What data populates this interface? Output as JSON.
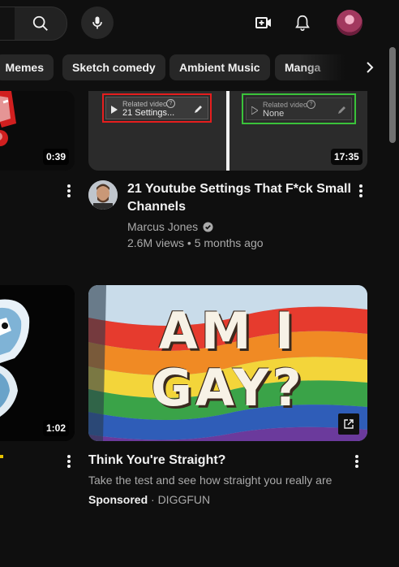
{
  "topbar": {
    "search_icon": "search-icon",
    "mic_icon": "mic-icon",
    "create_icon": "create-video-icon",
    "bell_icon": "bell-icon"
  },
  "chips": [
    "Memes",
    "Sketch comedy",
    "Ambient Music",
    "Manga"
  ],
  "video1": {
    "left_duration": "0:39",
    "duration": "17:35",
    "panel_left": {
      "label": "Related video",
      "value": "21 Settings..."
    },
    "panel_right": {
      "label": "Related video",
      "value": "None"
    },
    "title_line1": "21 Youtube Settings That F*ck Small",
    "title_line2": "Channels",
    "channel": "Marcus Jones",
    "stats": "2.6M views • 5 months ago"
  },
  "video2": {
    "left_duration": "1:02",
    "thumb_text_line1": "AM I",
    "thumb_text_line2": "GAY?",
    "title": "Think You're Straight?",
    "description": "Take the test and see how straight you really are",
    "sponsored": "Sponsored",
    "advertiser": "· DIGGFUN"
  },
  "colors": {
    "background": "#0f0f0f",
    "chip": "#272727",
    "red_highlight": "#e51e1e",
    "green_highlight": "#3ac23a"
  }
}
